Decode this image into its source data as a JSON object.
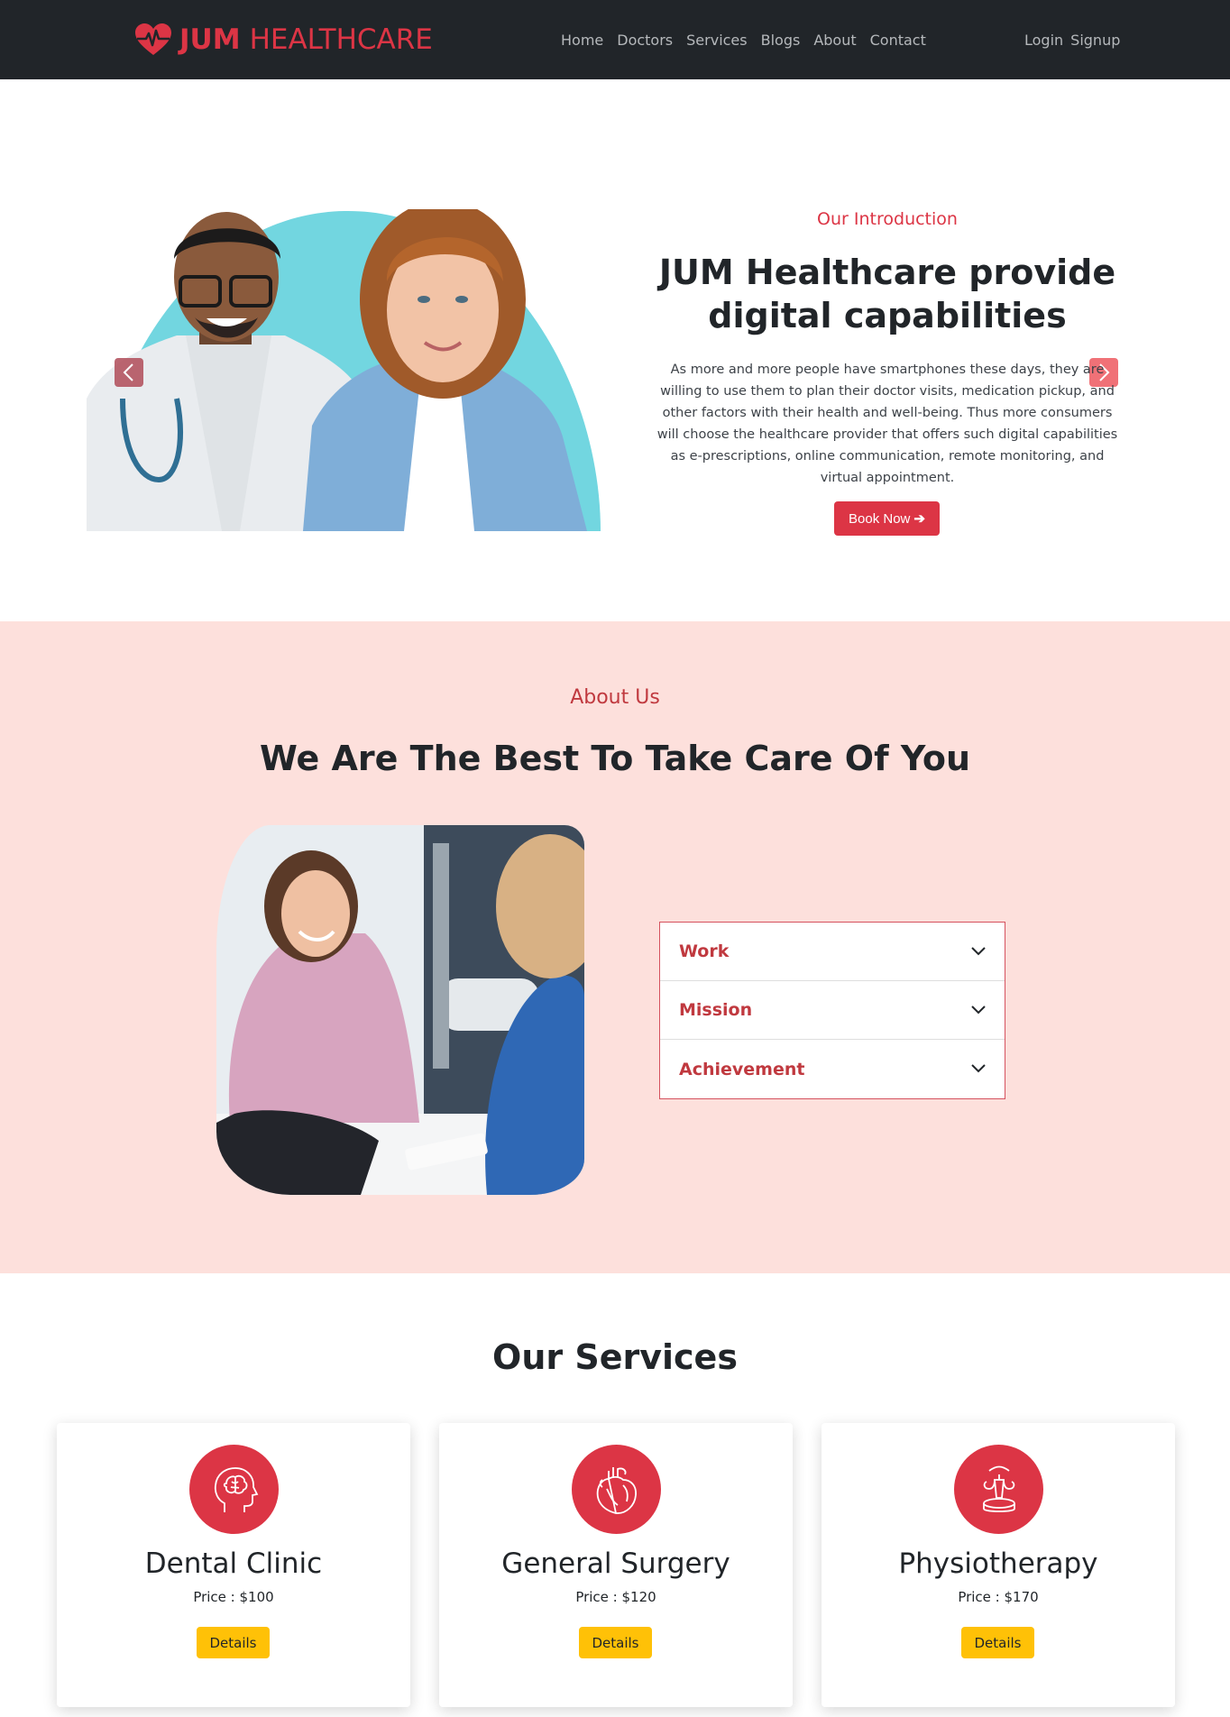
{
  "brand": {
    "strong": "JUM",
    "light": "HEALTHCARE",
    "color": "#dc3545"
  },
  "nav": {
    "links": [
      "Home",
      "Doctors",
      "Services",
      "Blogs",
      "About",
      "Contact"
    ],
    "login": "Login",
    "signup": "Signup"
  },
  "hero": {
    "subtitle": "Our Introduction",
    "title": "JUM Healthcare provide digital capabilities",
    "text": "As more and more people have smartphones these days, they are willing to use them to plan their doctor visits, medication pickup, and other factors with their health and well-being. Thus more consumers will choose the healthcare provider that offers such digital capabilities as e-prescriptions, online communication, remote monitoring, and virtual appointment.",
    "button": "Book Now",
    "button_icon": "arrow-right-icon"
  },
  "about": {
    "subtitle": "About Us",
    "title": "We Are The Best To Take Care Of You",
    "accordion": [
      {
        "label": "Work"
      },
      {
        "label": "Mission"
      },
      {
        "label": "Achievement"
      }
    ]
  },
  "services": {
    "title": "Our Services",
    "cards": [
      {
        "name": "Dental Clinic",
        "price": "Price : $100",
        "button": "Details",
        "icon": "brain-head-icon"
      },
      {
        "name": "General Surgery",
        "price": "Price : $120",
        "button": "Details",
        "icon": "heart-organ-icon"
      },
      {
        "name": "Physiotherapy",
        "price": "Price : $170",
        "button": "Details",
        "icon": "uterus-icon"
      }
    ]
  },
  "colors": {
    "primary": "#dc3545",
    "dark": "#212529",
    "about_bg": "#fde0dc",
    "warning": "#ffc107"
  }
}
